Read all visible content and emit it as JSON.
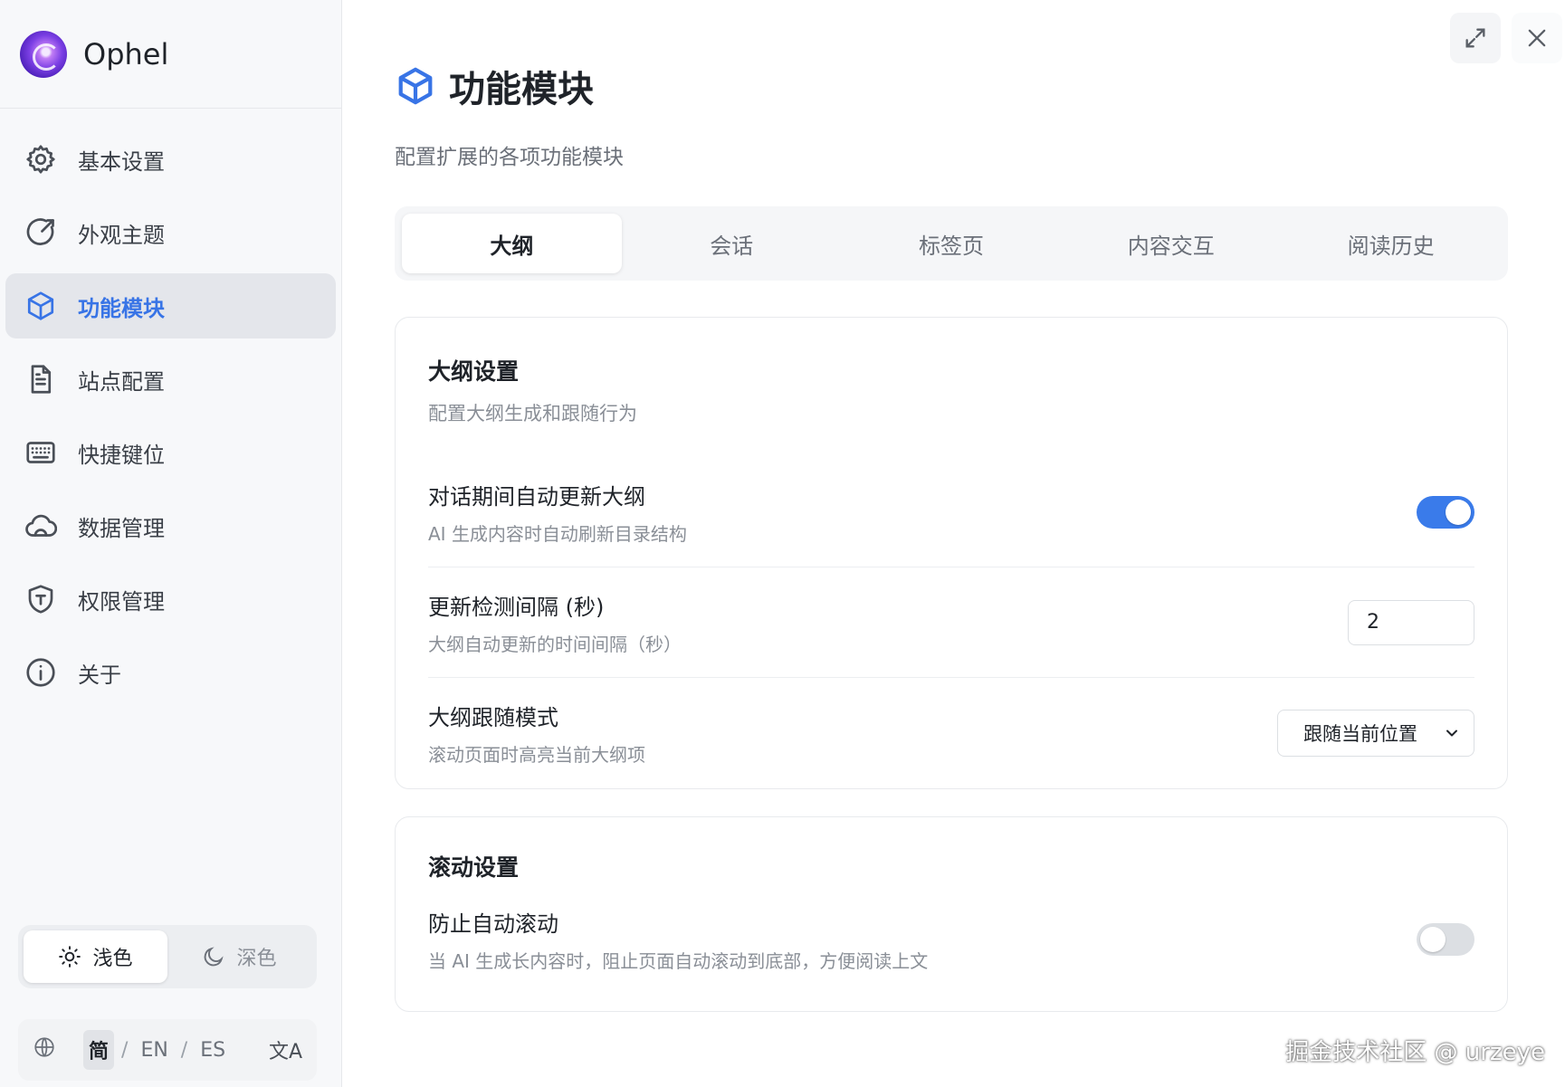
{
  "brand": {
    "name": "Ophel"
  },
  "sidebar": {
    "items": [
      {
        "label": "基本设置",
        "icon": "gear-icon"
      },
      {
        "label": "外观主题",
        "icon": "palette-icon"
      },
      {
        "label": "功能模块",
        "icon": "cube-icon"
      },
      {
        "label": "站点配置",
        "icon": "document-icon"
      },
      {
        "label": "快捷键位",
        "icon": "keyboard-icon"
      },
      {
        "label": "数据管理",
        "icon": "cloud-icon"
      },
      {
        "label": "权限管理",
        "icon": "shield-icon"
      },
      {
        "label": "关于",
        "icon": "info-icon"
      }
    ],
    "active_index": 2
  },
  "theme": {
    "light": "浅色",
    "dark": "深色",
    "active": "light"
  },
  "language": {
    "options": [
      "简",
      "EN",
      "ES"
    ],
    "separator": "/",
    "active": "简",
    "translate_glyph": "文A"
  },
  "page": {
    "title": "功能模块",
    "subtitle": "配置扩展的各项功能模块"
  },
  "tabs": [
    "大纲",
    "会话",
    "标签页",
    "内容交互",
    "阅读历史"
  ],
  "outline_card": {
    "title": "大纲设置",
    "desc": "配置大纲生成和跟随行为",
    "rows": [
      {
        "title": "对话期间自动更新大纲",
        "desc": "AI 生成内容时自动刷新目录结构",
        "toggle_on": true
      },
      {
        "title": "更新检测间隔 (秒)",
        "desc": "大纲自动更新的时间间隔（秒）",
        "value": "2"
      },
      {
        "title": "大纲跟随模式",
        "desc": "滚动页面时高亮当前大纲项",
        "selected": "跟随当前位置"
      }
    ]
  },
  "scroll_card": {
    "title": "滚动设置",
    "rows": [
      {
        "title": "防止自动滚动",
        "desc": "当 AI 生成长内容时，阻止页面自动滚动到底部，方便阅读上文",
        "toggle_on": false
      }
    ]
  },
  "watermark": "掘金技术社区 @ urzeye",
  "colors": {
    "accent": "#3874e6",
    "toggle_on": "#3a7bea",
    "active_nav_bg": "#e4e6eb"
  }
}
